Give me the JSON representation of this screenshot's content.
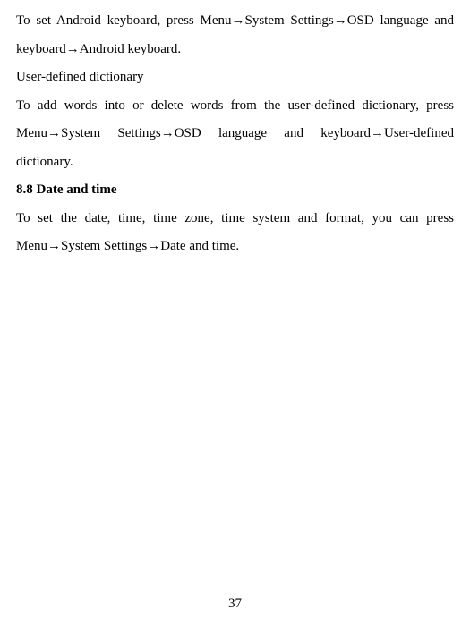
{
  "para1": "To set Android keyboard, press Menu→System Settings→OSD language and keyboard→Android keyboard.",
  "para2": "User-defined dictionary",
  "para3": "To add words into or delete words from the user-defined dictionary, press Menu→System Settings→OSD language and keyboard→User-defined dictionary.",
  "heading": "8.8 Date and time",
  "para4": "To set the date, time, time zone, time system and format, you can press Menu→System Settings→Date and time.",
  "pageNumber": "37"
}
